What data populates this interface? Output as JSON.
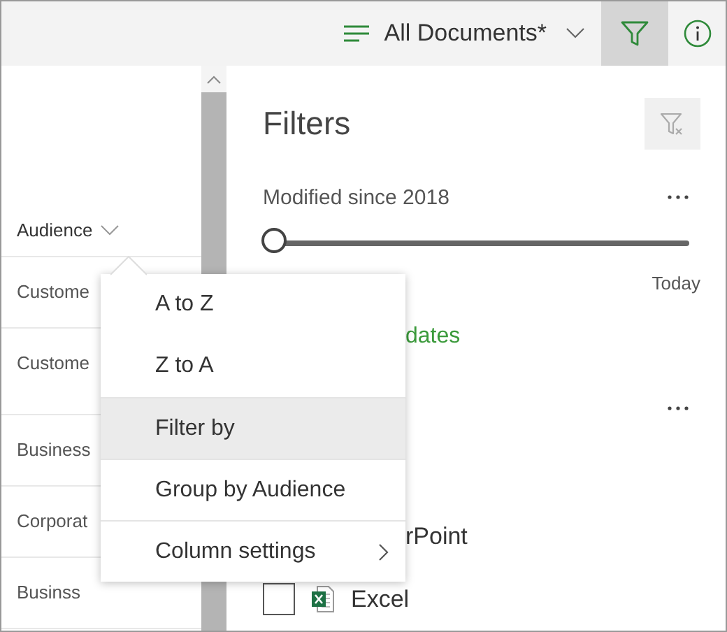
{
  "toolbar": {
    "view": "All Documents*",
    "filter_pane_open": true
  },
  "list": {
    "column": "Audience",
    "rows": [
      "Custome",
      "Custome",
      "Business",
      "Corporat",
      "Businss"
    ]
  },
  "filters": {
    "title": "Filters",
    "date_filter": {
      "title": "Modified since 2018",
      "level": 0,
      "end_label": "Today",
      "link": "dates"
    },
    "type_filter": {
      "items": [
        {
          "kind": "text",
          "label": "rPoint"
        },
        {
          "kind": "file",
          "label": "Excel",
          "checked": false
        }
      ]
    }
  },
  "menu": {
    "items": [
      {
        "label": "A to Z",
        "selected": false,
        "submenu": false
      },
      {
        "label": "Z to A",
        "selected": false,
        "submenu": false
      },
      {
        "label": "Filter by",
        "selected": true,
        "submenu": false
      },
      {
        "label": "Group by Audience",
        "selected": false,
        "submenu": false
      },
      {
        "label": "Column settings",
        "selected": false,
        "submenu": true
      }
    ]
  }
}
